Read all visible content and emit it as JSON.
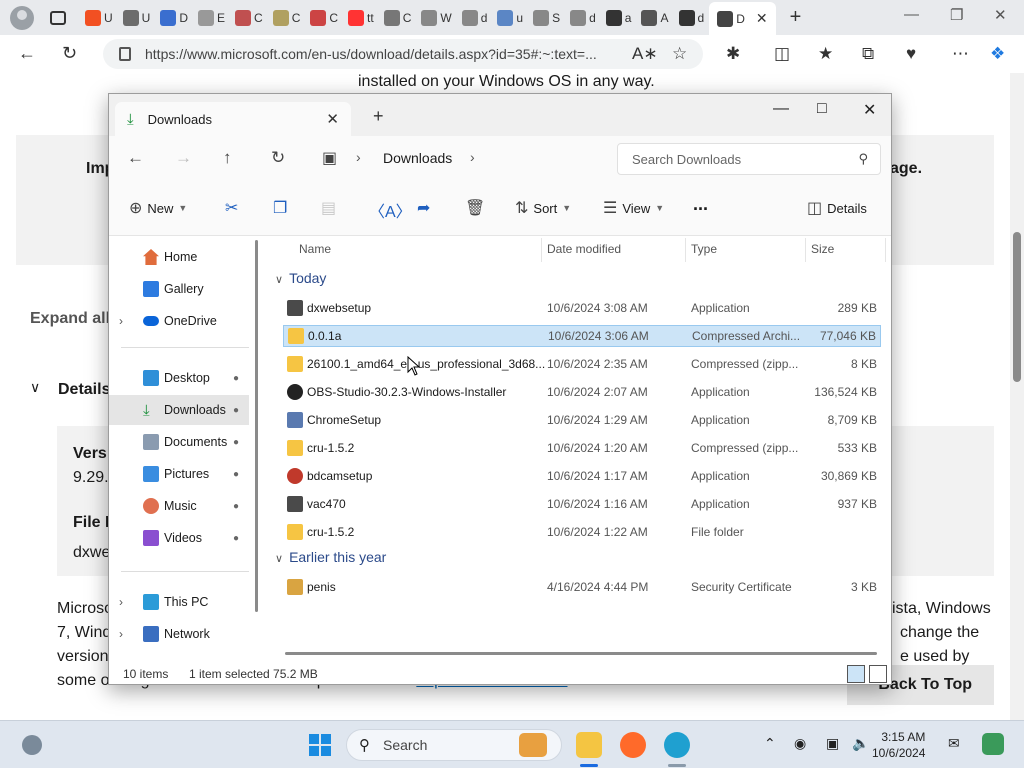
{
  "browser": {
    "tabs": [
      {
        "label": "U",
        "color": "#f25022"
      },
      {
        "label": "U",
        "color": "#6c6c6c"
      },
      {
        "label": "D",
        "color": "#3a6ecf"
      },
      {
        "label": "E",
        "color": "#999999"
      },
      {
        "label": "C",
        "color": "#c05050"
      },
      {
        "label": "C",
        "color": "#b0a060"
      },
      {
        "label": "C",
        "color": "#cc4444"
      },
      {
        "label": "tt",
        "color": "#ff3333"
      },
      {
        "label": "C",
        "color": "#777777"
      },
      {
        "label": "W",
        "color": "#888888"
      },
      {
        "label": "d",
        "color": "#888888"
      },
      {
        "label": "u",
        "color": "#5b86c5"
      },
      {
        "label": "S",
        "color": "#888888"
      },
      {
        "label": "d",
        "color": "#888888"
      },
      {
        "label": "a",
        "color": "#333333"
      },
      {
        "label": "A",
        "color": "#555555"
      },
      {
        "label": "d",
        "color": "#333333"
      },
      {
        "label": "D",
        "color": "#444444"
      }
    ],
    "url": "https://www.microsoft.com/en-us/download/details.aspx?id=35#:~:text=..."
  },
  "webpage": {
    "top_text": "installed on your Windows OS in any way.",
    "imp_fragment": "Imp",
    "age_fragment": "age.",
    "expand_all": "Expand all",
    "details": "Details",
    "version_label": "Versi",
    "version_value": "9.29.",
    "file_label": "File N",
    "file_value": "dxwe",
    "para_left_1": "Microso",
    "para_left_2": "7, Wind",
    "para_left_3": "version",
    "para_left_4": "some older games. For a detailed explanation see",
    "para_link": "https://aka.ms/directx",
    "para_right_1": "ista, Windows",
    "para_right_2": "change the",
    "para_right_3": "e used by",
    "back_to_top": "Back To Top"
  },
  "explorer": {
    "tab_title": "Downloads",
    "breadcrumb": "Downloads",
    "search_placeholder": "Search Downloads",
    "commands": {
      "new": "New",
      "sort": "Sort",
      "view": "View",
      "more": "...",
      "details": "Details"
    },
    "sidebar": {
      "home": "Home",
      "gallery": "Gallery",
      "onedrive": "OneDrive",
      "desktop": "Desktop",
      "downloads": "Downloads",
      "documents": "Documents",
      "pictures": "Pictures",
      "music": "Music",
      "videos": "Videos",
      "thispc": "This PC",
      "network": "Network"
    },
    "columns": {
      "name": "Name",
      "date": "Date modified",
      "type": "Type",
      "size": "Size"
    },
    "groups": {
      "today": "Today",
      "earlier": "Earlier this year"
    },
    "files_today": [
      {
        "name": "dxwebsetup",
        "date": "10/6/2024 3:08 AM",
        "type": "Application",
        "size": "289 KB",
        "icon": "installer-icon",
        "selected": false
      },
      {
        "name": "0.0.1a",
        "date": "10/6/2024 3:06 AM",
        "type": "Compressed Archi...",
        "size": "77,046 KB",
        "icon": "zip-folder-icon",
        "selected": true
      },
      {
        "name": "26100.1_amd64_en-us_professional_3d68...",
        "date": "10/6/2024 2:35 AM",
        "type": "Compressed (zipp...",
        "size": "8 KB",
        "icon": "zip-folder-icon",
        "selected": false
      },
      {
        "name": "OBS-Studio-30.2.3-Windows-Installer",
        "date": "10/6/2024 2:07 AM",
        "type": "Application",
        "size": "136,524 KB",
        "icon": "obs-icon",
        "selected": false
      },
      {
        "name": "ChromeSetup",
        "date": "10/6/2024 1:29 AM",
        "type": "Application",
        "size": "8,709 KB",
        "icon": "setup-icon",
        "selected": false
      },
      {
        "name": "cru-1.5.2",
        "date": "10/6/2024 1:20 AM",
        "type": "Compressed (zipp...",
        "size": "533 KB",
        "icon": "zip-folder-icon",
        "selected": false
      },
      {
        "name": "bdcamsetup",
        "date": "10/6/2024 1:17 AM",
        "type": "Application",
        "size": "30,869 KB",
        "icon": "bdcam-icon",
        "selected": false
      },
      {
        "name": "vac470",
        "date": "10/6/2024 1:16 AM",
        "type": "Application",
        "size": "937 KB",
        "icon": "installer-icon",
        "selected": false
      },
      {
        "name": "cru-1.5.2",
        "date": "10/6/2024 1:22 AM",
        "type": "File folder",
        "size": "",
        "icon": "folder-icon",
        "selected": false
      }
    ],
    "files_earlier": [
      {
        "name": "penis",
        "date": "4/16/2024 4:44 PM",
        "type": "Security Certificate",
        "size": "3 KB",
        "icon": "certificate-icon",
        "selected": false
      }
    ],
    "status": {
      "count": "10 items",
      "selection": "1 item selected  75.2 MB"
    }
  },
  "taskbar": {
    "search": "Search",
    "time": "3:15 AM",
    "date": "10/6/2024"
  },
  "colors": {
    "accent": "#0067b8",
    "selection": "#cce4f7",
    "folder": "#f6c543"
  }
}
